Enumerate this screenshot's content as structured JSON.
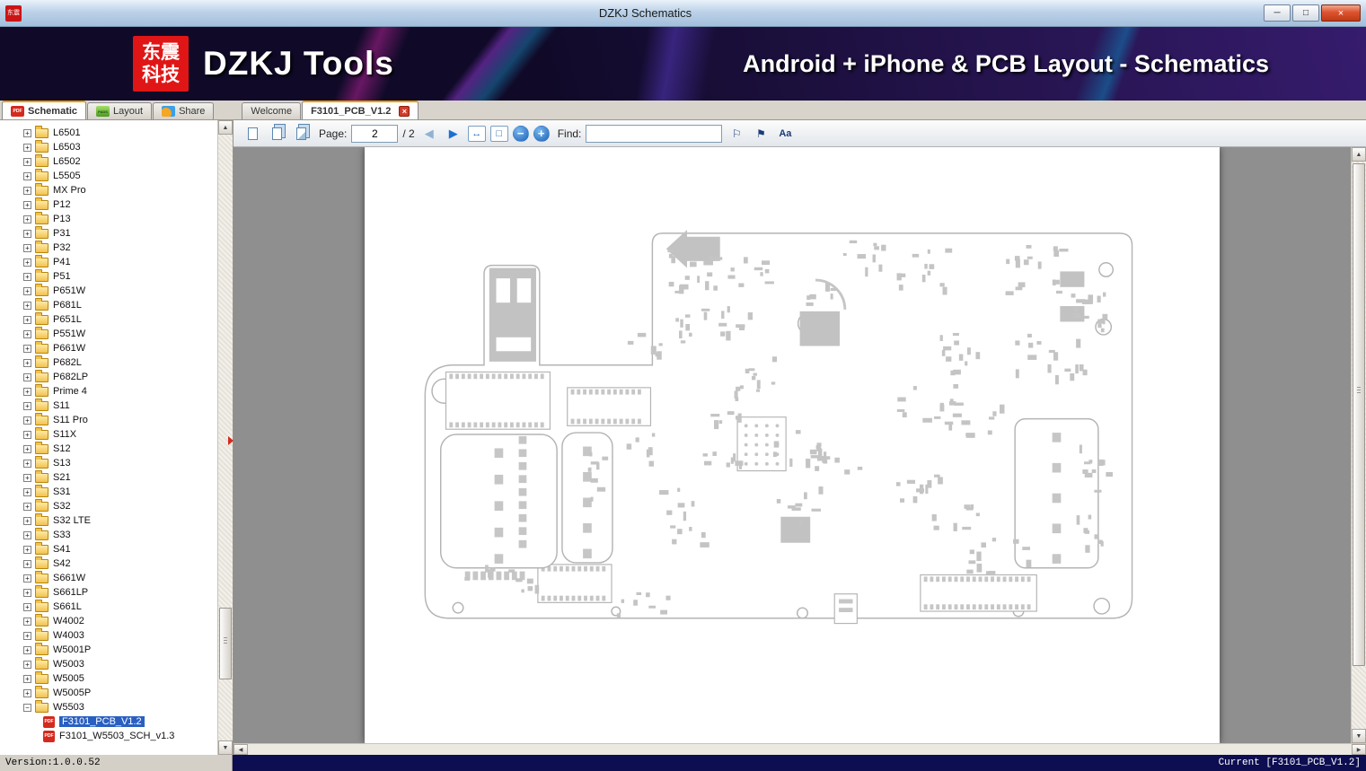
{
  "window": {
    "title": "DZKJ Schematics"
  },
  "banner": {
    "logo_line1": "东震",
    "logo_line2": "科技",
    "app_title": "DZKJ Tools",
    "subtitle": "Android + iPhone & PCB Layout - Schematics"
  },
  "main_tabs": [
    {
      "label": "Schematic",
      "icon": "pdf",
      "active": true
    },
    {
      "label": "Layout",
      "icon": "pads",
      "active": false
    },
    {
      "label": "Share",
      "icon": "share",
      "active": false
    }
  ],
  "doc_tabs": [
    {
      "label": "Welcome",
      "active": false,
      "closable": false
    },
    {
      "label": "F3101_PCB_V1.2",
      "active": true,
      "closable": true
    }
  ],
  "tab_icons": {
    "pdf": "PDF",
    "pads": "PADS",
    "share": ""
  },
  "sidebar": {
    "items": [
      "L6501",
      "L6503",
      "L6502",
      "L5505",
      "MX Pro",
      "P12",
      "P13",
      "P31",
      "P32",
      "P41",
      "P51",
      "P651W",
      "P681L",
      "P651L",
      "P551W",
      "P661W",
      "P682L",
      "P682LP",
      "Prime 4",
      "S11",
      "S11 Pro",
      "S11X",
      "S12",
      "S13",
      "S21",
      "S31",
      "S32",
      "S32 LTE",
      "S33",
      "S41",
      "S42",
      "S661W",
      "S661LP",
      "S661L",
      "W4002",
      "W4003",
      "W5001P",
      "W5003",
      "W5005",
      "W5005P"
    ],
    "expanded_folder": "W5503",
    "children": [
      {
        "label": "F3101_PCB_V1.2",
        "selected": true
      },
      {
        "label": "F3101_W5503_SCH_v1.3",
        "selected": false
      }
    ]
  },
  "toolbar": {
    "page_label": "Page:",
    "page_current": "2",
    "page_total": "/ 2",
    "find_label": "Find:",
    "find_value": ""
  },
  "statusbar": {
    "version": "Version:1.0.0.52",
    "current": "Current [F3101_PCB_V1.2]"
  },
  "glyphs": {
    "minimize": "─",
    "maximize": "□",
    "close": "×",
    "collapsed": "+",
    "expanded": "−",
    "prev_page": "◀",
    "next_page": "▶",
    "zoom_out": "−",
    "zoom_in": "+",
    "fit_width": "↔",
    "fit_page": "□",
    "find_prev": "⚐",
    "find_next": "⚑",
    "font_size": "Aa",
    "up": "▲",
    "down": "▼",
    "left": "◀",
    "right": "▶"
  },
  "colors": {
    "accent_red": "#d42a1e",
    "banner_bg": "#150e30",
    "selection_blue": "#2a5fc1",
    "status_navy": "#0d0d52"
  }
}
